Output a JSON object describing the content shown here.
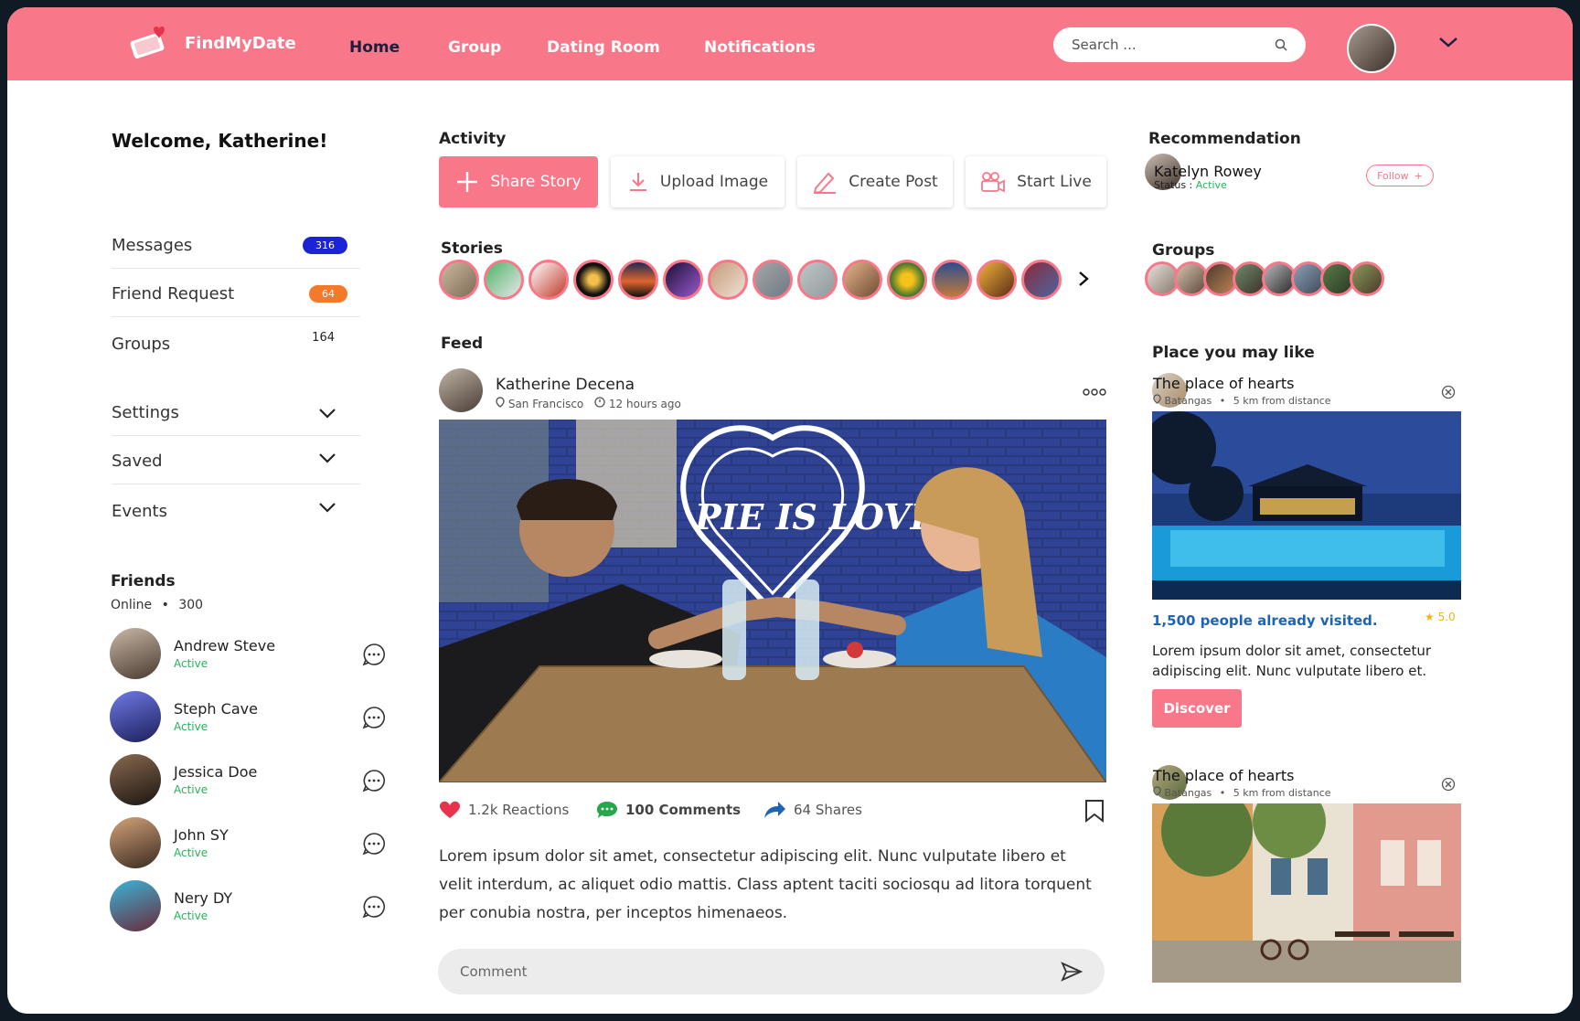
{
  "header": {
    "brand": "FindMyDate",
    "nav": [
      "Home",
      "Group",
      "Dating Room",
      "Notifications"
    ],
    "search_placeholder": "Search ..."
  },
  "sidebar": {
    "welcome": "Welcome, Katherine!",
    "items": [
      {
        "label": "Messages",
        "count": "316",
        "color": "#1b23d6"
      },
      {
        "label": "Friend Request",
        "count": "64",
        "color": "#f37a2a"
      },
      {
        "label": "Groups",
        "count": "164"
      }
    ],
    "collapsibles": [
      "Settings",
      "Saved",
      "Events"
    ],
    "friends": {
      "title": "Friends",
      "online_label": "Online",
      "online_count": "300",
      "list": [
        {
          "name": "Andrew Steve",
          "status": "Active"
        },
        {
          "name": "Steph Cave",
          "status": "Active"
        },
        {
          "name": "Jessica Doe",
          "status": "Active"
        },
        {
          "name": "John SY",
          "status": "Active"
        },
        {
          "name": "Nery DY",
          "status": "Active"
        }
      ]
    }
  },
  "activity": {
    "title": "Activity",
    "buttons": [
      "Share Story",
      "Upload Image",
      "Create Post",
      "Start Live"
    ]
  },
  "stories": {
    "title": "Stories"
  },
  "feed": {
    "title": "Feed",
    "post": {
      "author": "Katherine Decena",
      "location": "San Francisco",
      "time": "12 hours ago",
      "image_text": "PIE IS LOVE",
      "reactions": "1.2k Reactions",
      "comments": "100 Comments",
      "shares": "64 Shares",
      "body": "Lorem ipsum dolor sit amet, consectetur adipiscing elit. Nunc vulputate libero et velit interdum, ac aliquet odio mattis. Class aptent taciti sociosqu ad litora torquent per conubia nostra, per inceptos himenaeos.",
      "comment_placeholder": "Comment"
    }
  },
  "right": {
    "recommendation_title": "Recommendation",
    "rec_user": "Katelyn Rowey",
    "rec_status_label": "Status :",
    "rec_status": "Active",
    "follow_label": "Follow",
    "groups_title": "Groups",
    "places_title": "Place you may like",
    "places": [
      {
        "name": "The place of hearts",
        "location": "Batangas",
        "distance": "5 km from distance"
      },
      {
        "name": "The place of hearts",
        "location": "Batangas",
        "distance": "5 km from distance"
      }
    ],
    "visited": "1,500 people already visited.",
    "rating": "5.0",
    "description": "Lorem ipsum dolor sit amet, consectetur adipiscing elit. Nunc vulputate libero et.",
    "discover_label": "Discover"
  }
}
